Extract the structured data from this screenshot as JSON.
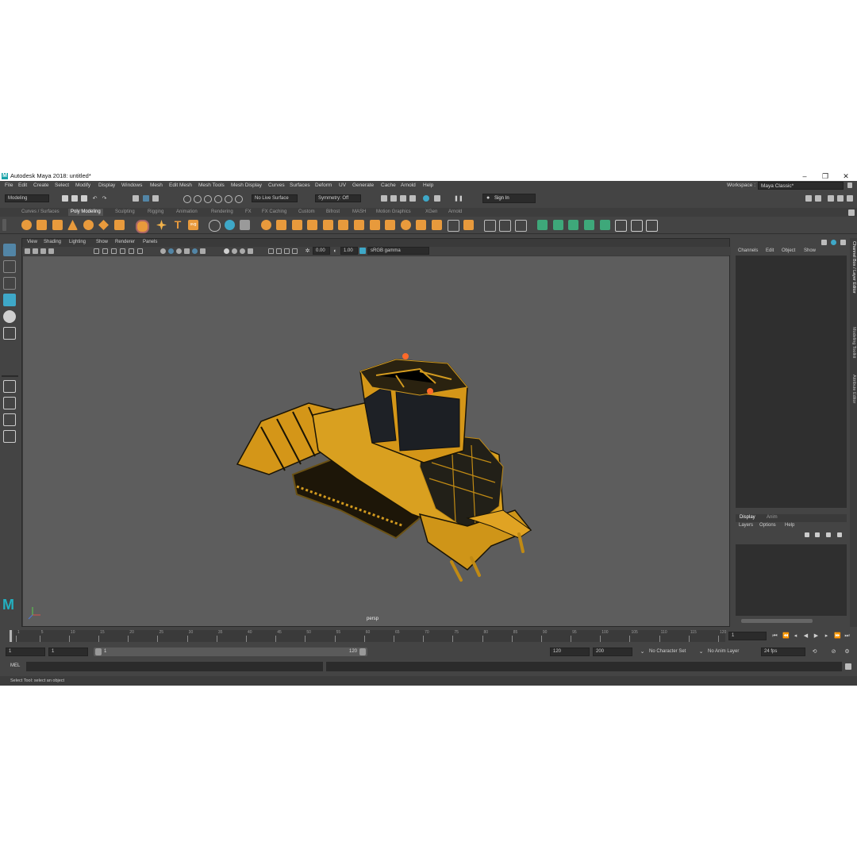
{
  "window": {
    "title": "Autodesk Maya 2018: untitled*",
    "logo_letter": "M",
    "minimize": "–",
    "maximize": "❐",
    "close": "✕"
  },
  "menu": [
    "File",
    "Edit",
    "Create",
    "Select",
    "Modify",
    "Display",
    "Windows",
    "Mesh",
    "Edit Mesh",
    "Mesh Tools",
    "Mesh Display",
    "Curves",
    "Surfaces",
    "Deform",
    "UV",
    "Generate",
    "Cache",
    "Arnold",
    "Help"
  ],
  "workspace": {
    "label": "Workspace :",
    "value": "Maya Classic*"
  },
  "toolbar": {
    "menuset": "Modeling",
    "live_surface": "No Live Surface",
    "symmetry": "Symmetry: Off",
    "sign_in": "Sign In"
  },
  "shelf_tabs": [
    "Curves / Surfaces",
    "Poly Modeling",
    "Sculpting",
    "Rigging",
    "Animation",
    "Rendering",
    "FX",
    "FX Caching",
    "Custom",
    "Bifrost",
    "MASH",
    "Motion Graphics",
    "XGen",
    "Arnold"
  ],
  "shelf_active": "Poly Modeling",
  "shelf_text_tools": {
    "type": "T",
    "svg": "svg"
  },
  "viewport": {
    "menu": [
      "View",
      "Shading",
      "Lighting",
      "Show",
      "Renderer",
      "Panels"
    ],
    "exposure": "0.00",
    "gamma": "1.00",
    "colorspace": "sRGB gamma",
    "camera": "persp"
  },
  "channel_box": {
    "menu": [
      "Channels",
      "Edit",
      "Object",
      "Show"
    ]
  },
  "layer_editor": {
    "tabs": [
      "Display",
      "Anim"
    ],
    "menu": [
      "Layers",
      "Options",
      "Help"
    ]
  },
  "side_tabs": [
    "Channel Box / Layer Editor",
    "Modeling Toolkit",
    "Attribute Editor"
  ],
  "timeline": {
    "ticks": [
      "1",
      "5",
      "10",
      "15",
      "20",
      "25",
      "30",
      "35",
      "40",
      "45",
      "50",
      "55",
      "60",
      "65",
      "70",
      "75",
      "80",
      "85",
      "90",
      "95",
      "100",
      "105",
      "110",
      "115",
      "120"
    ],
    "current_frame": "1"
  },
  "range": {
    "start": "1",
    "playback_start": "1",
    "slider_start": "1",
    "slider_end": "120",
    "playback_end": "120",
    "end": "200",
    "character_set": "No Character Set",
    "anim_layer": "No Anim Layer",
    "fps": "24 fps"
  },
  "command_line": {
    "label": "MEL"
  },
  "help_line": {
    "text": "Select Tool: select an object"
  },
  "colors": {
    "background": "#444444",
    "viewport": "#5d5d5d",
    "accent": "#5285a6",
    "shelf_orange": "#e89a3c",
    "shelf_green": "#3ea87a",
    "model_yellow": "#e0a323"
  }
}
